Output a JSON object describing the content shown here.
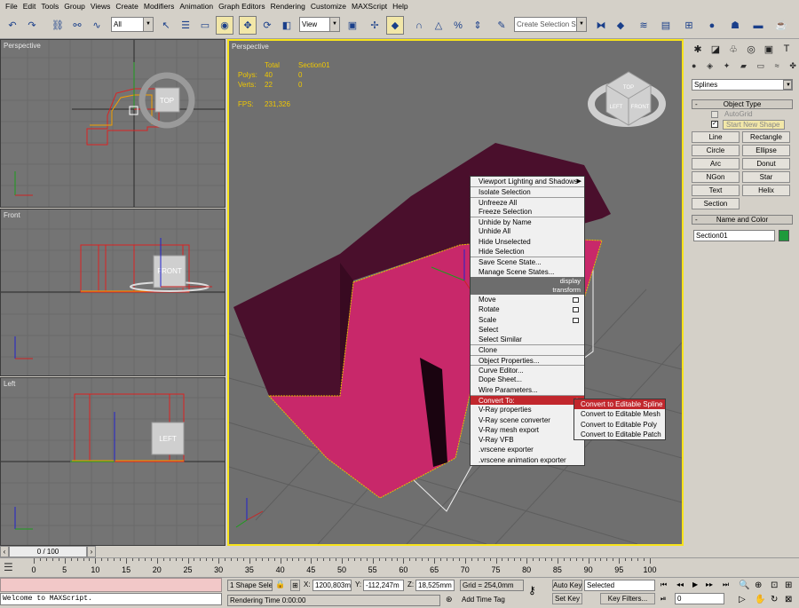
{
  "menu": [
    "File",
    "Edit",
    "Tools",
    "Group",
    "Views",
    "Create",
    "Modifiers",
    "Animation",
    "Graph Editors",
    "Rendering",
    "Customize",
    "MAXScript",
    "Help"
  ],
  "toolbar": {
    "filter_value": "All",
    "refcoord_value": "View",
    "named_selection_placeholder": "Create Selection Se"
  },
  "viewports": {
    "top": {
      "label": "Perspective",
      "cube_label": "TOP"
    },
    "front": {
      "label": "Front",
      "cube_label": "FRONT"
    },
    "left": {
      "label": "Left",
      "cube_label": "LEFT"
    },
    "perspective": {
      "label": "Perspective",
      "stats": {
        "col_total": "Total",
        "col_object": "Section01",
        "polys_label": "Polys:",
        "polys_total": "40",
        "polys_obj": "0",
        "verts_label": "Verts:",
        "verts_total": "22",
        "verts_obj": "0",
        "fps_label": "FPS:",
        "fps_value": "231,326"
      },
      "cube_labels": [
        "TOP",
        "LEFT",
        "FRONT"
      ]
    }
  },
  "context_menu": {
    "items": [
      {
        "label": "Viewport Lighting and Shadows",
        "arrow": true
      },
      {
        "label": "Isolate Selection",
        "sep": true
      },
      {
        "label": "Unfreeze All",
        "sep": true
      },
      {
        "label": "Freeze Selection"
      },
      {
        "label": "Unhide by Name",
        "sep": true
      },
      {
        "label": "Unhide All"
      },
      {
        "label": "Hide Unselected"
      },
      {
        "label": "Hide Selection"
      },
      {
        "label": "Save Scene State...",
        "sep": true
      },
      {
        "label": "Manage Scene States..."
      }
    ],
    "header_display": "display",
    "header_transform": "transform",
    "items2": [
      {
        "label": "Move",
        "box": true
      },
      {
        "label": "Rotate",
        "box": true
      },
      {
        "label": "Scale",
        "box": true
      },
      {
        "label": "Select"
      },
      {
        "label": "Select Similar"
      },
      {
        "label": "Clone",
        "sep": true
      },
      {
        "label": "Object Properties...",
        "sep": true
      },
      {
        "label": "Curve Editor...",
        "sep": true
      },
      {
        "label": "Dope Sheet..."
      },
      {
        "label": "Wire Parameters..."
      },
      {
        "label": "Convert To:",
        "sep": true,
        "arrow": true,
        "hl": true
      },
      {
        "label": "V-Ray properties"
      },
      {
        "label": "V-Ray scene converter"
      },
      {
        "label": "V-Ray mesh export"
      },
      {
        "label": "V-Ray VFB"
      },
      {
        "label": ".vrscene exporter"
      },
      {
        "label": ".vrscene animation exporter"
      }
    ],
    "submenu": [
      {
        "label": "Convert to Editable Spline",
        "hl": true
      },
      {
        "label": "Convert to Editable Mesh"
      },
      {
        "label": "Convert to Editable Poly"
      },
      {
        "label": "Convert to Editable Patch"
      }
    ]
  },
  "command_panel": {
    "category_value": "Splines",
    "object_type_title": "Object Type",
    "autogrid_label": "AutoGrid",
    "start_new_shape_label": "Start New Shape",
    "buttons": [
      "Line",
      "Rectangle",
      "Circle",
      "Ellipse",
      "Arc",
      "Donut",
      "NGon",
      "Star",
      "Text",
      "Helix",
      "Section"
    ],
    "name_color_title": "Name and Color",
    "object_name": "Section01",
    "object_color": "#1f9a3c",
    "rollout_minus": "-"
  },
  "timeline": {
    "frame_counter": "0 / 100",
    "ticks": [
      "0",
      "5",
      "10",
      "15",
      "20",
      "25",
      "30",
      "35",
      "40",
      "45",
      "50",
      "55",
      "60",
      "65",
      "70",
      "75",
      "80",
      "85",
      "90",
      "95",
      "100"
    ]
  },
  "status": {
    "maxscript_text": "Welcome to MAXScript.",
    "selection_count": "1 Shape Sele",
    "x_label": "X:",
    "x_value": "1200,803m",
    "y_label": "Y:",
    "y_value": "-112,247m",
    "z_label": "Z:",
    "z_value": "18,525mm",
    "grid_text": "Grid = 254,0mm",
    "rendering_time": "Rendering Time  0:00:00",
    "add_time_tag": "Add Time Tag",
    "auto_key": "Auto Key",
    "selected_value": "Selected",
    "set_key": "Set Key",
    "key_filters": "Key Filters...",
    "frame_value": "0"
  },
  "colors": {
    "viewport_bg": "#747474",
    "active_border": "#f7e31a",
    "wall": "#4a0f2c",
    "floor": "#c8286a",
    "highlight": "#c1272d"
  }
}
